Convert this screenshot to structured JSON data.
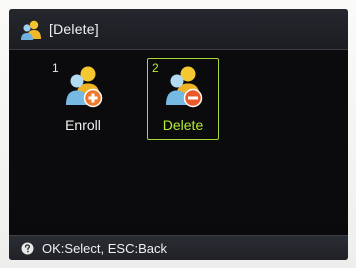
{
  "titlebar": {
    "title": "[Delete]",
    "icon": "users-icon"
  },
  "menu": {
    "items": [
      {
        "number": "1",
        "label": "Enroll",
        "icon": "user-add-icon",
        "selected": false
      },
      {
        "number": "2",
        "label": "Delete",
        "icon": "user-remove-icon",
        "selected": true
      }
    ]
  },
  "statusbar": {
    "hint": "OK:Select, ESC:Back",
    "icon": "help-icon"
  },
  "colors": {
    "selection": "#b6ee32",
    "add_badge": "#f07a2a",
    "remove_badge": "#e85a2a"
  }
}
